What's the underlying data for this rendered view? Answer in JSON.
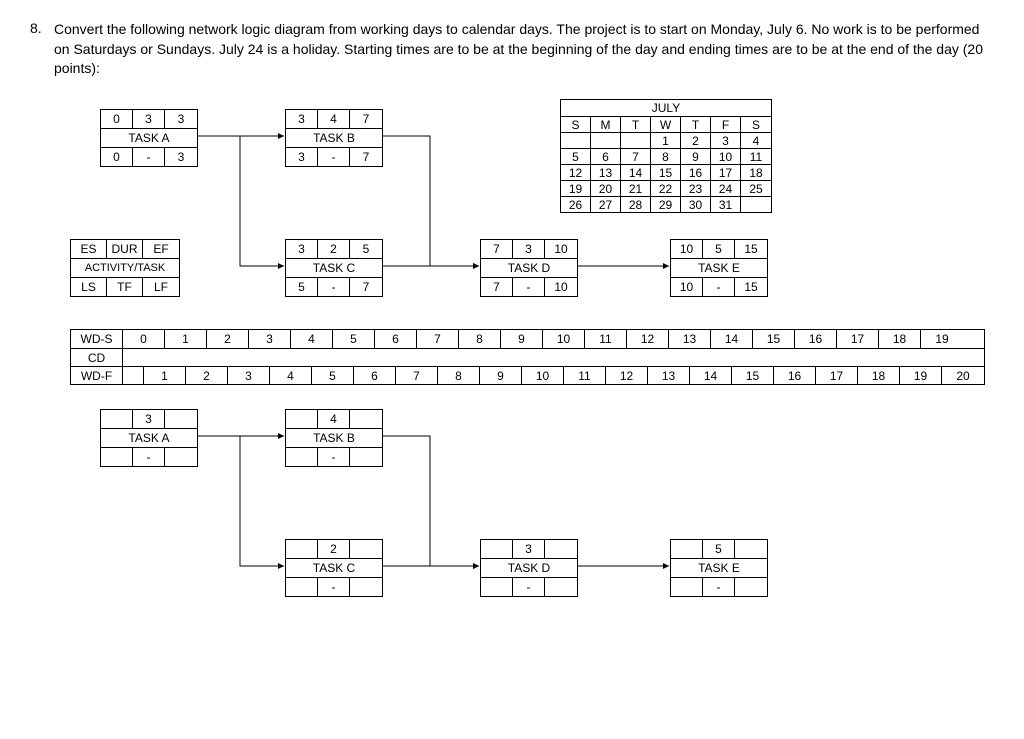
{
  "question": {
    "number": "8.",
    "text": "Convert the following network logic diagram from working days to calendar days.  The project is to start on Monday, July 6.  No work is to be performed on Saturdays or Sundays.  July 24 is a holiday.  Starting times are to be at the beginning of the day and ending times are to be at the end of the day (20 points):"
  },
  "legend": {
    "row1": [
      "ES",
      "DUR",
      "EF"
    ],
    "title": "ACTIVITY/TASK",
    "row2": [
      "LS",
      "TF",
      "LF"
    ]
  },
  "tasks_wd": {
    "A": {
      "es": "0",
      "dur": "3",
      "ef": "3",
      "ls": "0",
      "tf": "-",
      "lf": "3",
      "name": "TASK A"
    },
    "B": {
      "es": "3",
      "dur": "4",
      "ef": "7",
      "ls": "3",
      "tf": "-",
      "lf": "7",
      "name": "TASK B"
    },
    "C": {
      "es": "3",
      "dur": "2",
      "ef": "5",
      "ls": "5",
      "tf": "-",
      "lf": "7",
      "name": "TASK C"
    },
    "D": {
      "es": "7",
      "dur": "3",
      "ef": "10",
      "ls": "7",
      "tf": "-",
      "lf": "10",
      "name": "TASK D"
    },
    "E": {
      "es": "10",
      "dur": "5",
      "ef": "15",
      "ls": "10",
      "tf": "-",
      "lf": "15",
      "name": "TASK E"
    }
  },
  "tasks_cd": {
    "A": {
      "dur": "3",
      "name": "TASK A",
      "dash": "-"
    },
    "B": {
      "dur": "4",
      "name": "TASK B",
      "dash": "-"
    },
    "C": {
      "dur": "2",
      "name": "TASK C",
      "dash": "-"
    },
    "D": {
      "dur": "3",
      "name": "TASK D",
      "dash": "-"
    },
    "E": {
      "dur": "5",
      "name": "TASK E",
      "dash": "-"
    }
  },
  "calendar": {
    "title": "JULY",
    "dow": [
      "S",
      "M",
      "T",
      "W",
      "T",
      "F",
      "S"
    ],
    "rows": [
      [
        "",
        "",
        "",
        "1",
        "2",
        "3",
        "4"
      ],
      [
        "5",
        "6",
        "7",
        "8",
        "9",
        "10",
        "11"
      ],
      [
        "12",
        "13",
        "14",
        "15",
        "16",
        "17",
        "18"
      ],
      [
        "19",
        "20",
        "21",
        "22",
        "23",
        "24",
        "25"
      ],
      [
        "26",
        "27",
        "28",
        "29",
        "30",
        "31",
        ""
      ]
    ]
  },
  "strip": {
    "labels": [
      "WD-S",
      "CD",
      "WD-F"
    ],
    "wds": [
      "0",
      "1",
      "2",
      "3",
      "4",
      "5",
      "6",
      "7",
      "8",
      "9",
      "10",
      "11",
      "12",
      "13",
      "14",
      "15",
      "16",
      "17",
      "18",
      "19"
    ],
    "wdf": [
      "1",
      "2",
      "3",
      "4",
      "5",
      "6",
      "7",
      "8",
      "9",
      "10",
      "11",
      "12",
      "13",
      "14",
      "15",
      "16",
      "17",
      "18",
      "19",
      "20"
    ]
  }
}
